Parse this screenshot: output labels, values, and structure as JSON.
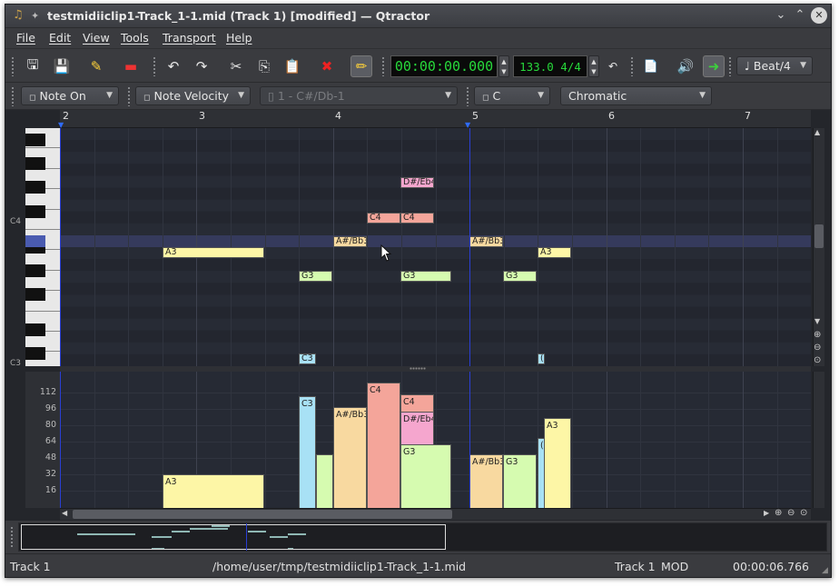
{
  "window": {
    "title": "testmidiiclip1-Track_1-1.mid (Track 1) [modified] — Qtractor",
    "controls": [
      "chevron-down",
      "chevron-up",
      "close"
    ]
  },
  "menu": [
    "File",
    "Edit",
    "View",
    "Tools",
    "Transport",
    "Help"
  ],
  "toolbar": {
    "time_display": "00:00:00.000",
    "tempo_display": "133.0 4/4",
    "snap_value": "Beat/4"
  },
  "view_toolbar": {
    "event_type": "Note On",
    "event_param": "Note Velocity",
    "event_param2": "1 - C#/Db-1",
    "scale_key": "C",
    "scale_type": "Chromatic"
  },
  "ruler": {
    "bars": [
      "2",
      "3",
      "4",
      "5",
      "6",
      "7"
    ]
  },
  "keyboard": {
    "labels": [
      "C4",
      "C3"
    ]
  },
  "notes": [
    {
      "label": "D#/Eb4",
      "color": "#f5a6ce"
    },
    {
      "label": "C4",
      "color": "#f4a59a"
    },
    {
      "label": "C4",
      "color": "#f4a59a"
    },
    {
      "label": "A3",
      "color": "#fdf6a6"
    },
    {
      "label": "A#/Bb3",
      "color": "#f8d9a0"
    },
    {
      "label": "A#/Bb3",
      "color": "#f8d9a0"
    },
    {
      "label": "A3",
      "color": "#fdf6a6"
    },
    {
      "label": "G3",
      "color": "#d6fbb0"
    },
    {
      "label": "G3",
      "color": "#d6fbb0"
    },
    {
      "label": "G3",
      "color": "#d6fbb0"
    },
    {
      "label": "C3",
      "color": "#a8e1f5"
    },
    {
      "label": "(",
      "color": "#a8e1f5"
    }
  ],
  "velocity": {
    "scale": [
      "112",
      "96",
      "80",
      "64",
      "48",
      "32",
      "16"
    ],
    "bars": [
      {
        "label": "A3",
        "color": "#fdf6a6"
      },
      {
        "label": "C3",
        "color": "#a8e1f5"
      },
      {
        "label": "",
        "color": "#d6fbb0"
      },
      {
        "label": "A#/Bb3",
        "color": "#f8d9a0"
      },
      {
        "label": "C4",
        "color": "#f4a59a"
      },
      {
        "label": "C4",
        "color": "#f4a59a"
      },
      {
        "label": "D#/Eb4",
        "color": "#f5a6ce"
      },
      {
        "label": "G3",
        "color": "#d6fbb0"
      },
      {
        "label": "A#/Bb3",
        "color": "#f8d9a0"
      },
      {
        "label": "G3",
        "color": "#d6fbb0"
      },
      {
        "label": "(",
        "color": "#a8e1f5"
      },
      {
        "label": "A3",
        "color": "#fdf6a6"
      }
    ]
  },
  "status": {
    "track": "Track 1",
    "file": "/home/user/tmp/testmidiiclip1-Track_1-1.mid",
    "track2": "Track 1",
    "mod": "MOD",
    "time": "00:00:06.766"
  }
}
